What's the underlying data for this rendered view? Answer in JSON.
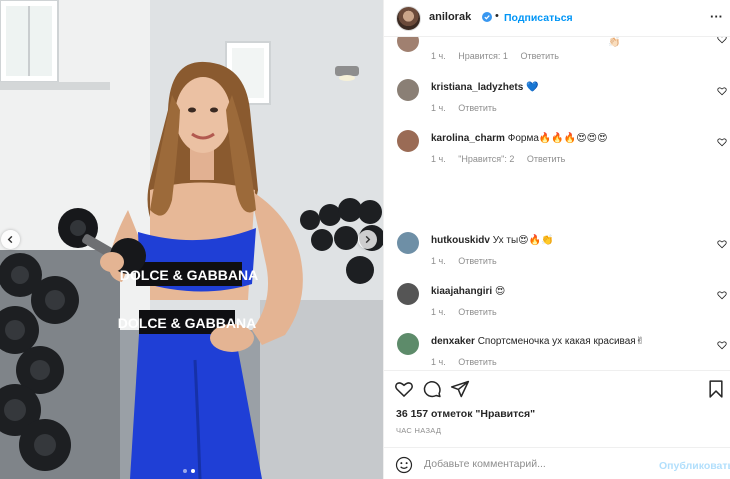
{
  "post_header": {
    "username": "anilorak",
    "separator": "•",
    "follow_label": "Подписаться",
    "more_label": "···"
  },
  "photo": {
    "brand_top": "DOLCE & GABBANA",
    "brand_bottom": "DOLCE & GABBANA",
    "carousel_dots": 2,
    "active_dot": 1
  },
  "comments": [
    {
      "username": "",
      "text": "",
      "time": "1 ч.",
      "likes": "Нравится: 1",
      "reply": "Ответить",
      "emoji": "👏🏻",
      "avatar_color": "#a08070"
    },
    {
      "username": "kristiana_ladyzhets",
      "text": "💙",
      "time": "1 ч.",
      "likes": "",
      "reply": "Ответить",
      "avatar_color": "#8a7f75"
    },
    {
      "username": "karolina_charm",
      "text": "Форма🔥🔥🔥😍😍😍",
      "time": "1 ч.",
      "likes": "\"Нравится\": 2",
      "reply": "Ответить",
      "avatar_color": "#9a6b55"
    },
    {
      "username": "hutkouskidv",
      "text": "Ух ты😍🔥👏",
      "time": "1 ч.",
      "likes": "",
      "reply": "Ответить",
      "avatar_color": "#6e8fa6"
    },
    {
      "username": "kiaajahangiri",
      "text": "😍",
      "time": "1 ч.",
      "likes": "",
      "reply": "Ответить",
      "avatar_color": "#555555"
    },
    {
      "username": "denxaker",
      "text": "Спортсменочка ух какая красивая✌",
      "time": "1 ч.",
      "likes": "",
      "reply": "Ответить",
      "avatar_color": "#5d8b6a"
    }
  ],
  "actions": {
    "like_icon": "heart-outline-icon",
    "comment_icon": "comment-bubble-icon",
    "share_icon": "paper-plane-icon",
    "save_icon": "bookmark-icon"
  },
  "likes_text": "36 157 отметок \"Нравится\"",
  "time_ago": "час назад",
  "add_comment": {
    "placeholder": "Добавьте комментарий...",
    "publish_label": "Опубликовать"
  },
  "colors": {
    "accent": "#0095f6",
    "publish_disabled": "#b2dffc",
    "muted": "#8e8e8e",
    "outfit_blue": "#1f3fd6"
  }
}
